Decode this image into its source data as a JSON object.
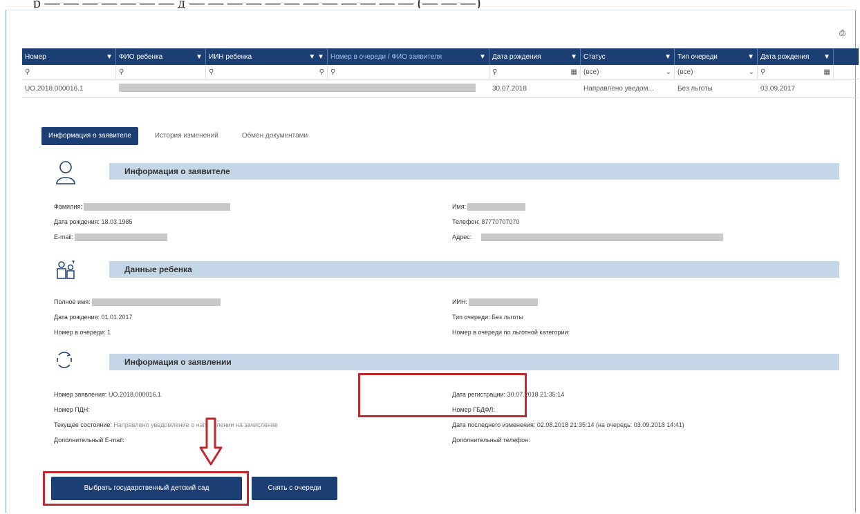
{
  "doc_line": "р — — — — — — — д — — — — — — — — — — — — (— — —)",
  "grid": {
    "columns": [
      "Номер",
      "ФИО ребенка",
      "ИИН ребенка",
      "Номер в очереди / ФИО заявителя",
      "Дата рождения",
      "Статус",
      "Тип очереди",
      "Дата рождения"
    ],
    "filter": {
      "status_value": "(все)",
      "queue_value": "(все)"
    },
    "row": {
      "number": "UO.2018.000016.1",
      "birth_date": "30.07.2018",
      "status": "Направлено уведом...",
      "queue_type": "Без льготы",
      "date2": "03.09.2017"
    }
  },
  "tabs": [
    "Информация о заявителе",
    "История изменений",
    "Обмен документами"
  ],
  "applicant": {
    "title": "Информация о заявителе",
    "surname_label": "Фамилия:",
    "birth_label": "Дата рождения:",
    "birth_value": "18.03.1985",
    "email_label": "E-mail:",
    "name_label": "Имя:",
    "phone_label": "Телефон:",
    "phone_value": "87770707070",
    "address_label": "Адрес:"
  },
  "child": {
    "title": "Данные ребенка",
    "fullname_label": "Полное имя:",
    "birth_label": "Дата рождения:",
    "birth_value": "01.01.2017",
    "queue_label": "Номер в очереди:",
    "queue_value": "1",
    "iin_label": "ИИН:",
    "queue_type_label": "Тип очереди:",
    "queue_type_value": "Без льготы",
    "queue_cat_label": "Номер в очереди по льготной категории:",
    "queue_cat_value": ""
  },
  "application": {
    "title": "Информация о заявлении",
    "app_no_label": "Номер заявления:",
    "app_no_value": "UO.2018.000016.1",
    "pdn_label": "Номер ПДН:",
    "status_label": "Текущее состояние:",
    "status_value": "Направлено уведомление о направлении на зачисление",
    "email_label": "Дополнительный E-mail:",
    "reg_label": "Дата регистрации:",
    "reg_value": "30.07.2018 21:35:14",
    "gbdfl_label": "Номер ГБДФЛ:",
    "last_label": "Дата последнего изменения:",
    "last_value": "02.08.2018 21:35:14 (на очередь: 03.09.2018 14:41)",
    "phone_label": "Дополнительный телефон:"
  },
  "buttons": {
    "choose": "Выбрать государственный детский сад",
    "cancel": "Снять с очереди"
  },
  "colors": {
    "header": "#1c3f73",
    "section_bar": "#c5d7e6",
    "highlight": "#c0282e"
  }
}
